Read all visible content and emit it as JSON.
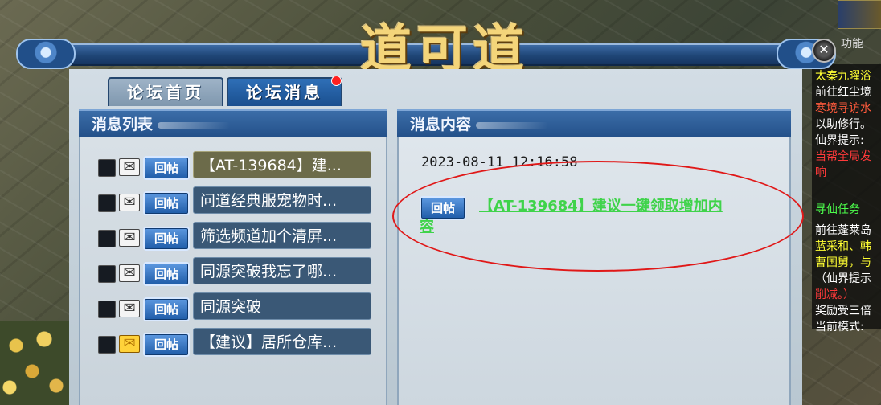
{
  "window": {
    "title": "道可道",
    "close_symbol": "✕"
  },
  "tabs": [
    {
      "label": "论坛首页",
      "active": false
    },
    {
      "label": "论坛消息",
      "active": true,
      "has_notification": true
    }
  ],
  "message_list": {
    "header": "消息列表",
    "reply_label": "回帖",
    "items": [
      {
        "title": "【AT-139684】建...",
        "selected": true,
        "unread": false
      },
      {
        "title": "问道经典服宠物时...",
        "selected": false,
        "unread": false
      },
      {
        "title": "筛选频道加个清屏...",
        "selected": false,
        "unread": false
      },
      {
        "title": "同源突破我忘了哪...",
        "selected": false,
        "unread": false
      },
      {
        "title": "同源突破",
        "selected": false,
        "unread": false
      },
      {
        "title": "【建议】居所仓库...",
        "selected": false,
        "unread": true
      }
    ]
  },
  "message_content": {
    "header": "消息内容",
    "timestamp": "2023-08-11 12:16:58",
    "reply_label": "回帖",
    "link_line1": "【AT-139684】建议一键领取增加内",
    "link_line2": "容"
  },
  "sidebar": {
    "top_label": "功能",
    "lines": [
      {
        "text": "太秦九曜浴",
        "color": "#ffff33"
      },
      {
        "text": "前往红尘境",
        "color": "#ffffff"
      },
      {
        "text": "寒境寻访水",
        "color": "#ff5a3c"
      },
      {
        "text": "以助修行。",
        "color": "#ffffff"
      },
      {
        "text": "仙界提示:",
        "color": "#ffffff"
      },
      {
        "text": "当帮全局发",
        "color": "#ff3a3a"
      },
      {
        "text": "响",
        "color": "#ff3a3a"
      },
      {
        "text": "寻仙任务",
        "color": "#4cff4c"
      },
      {
        "text": "前往蓬莱岛",
        "color": "#ffffff"
      },
      {
        "text": "蓝采和、韩",
        "color": "#ffff33"
      },
      {
        "text": "曹国舅，与",
        "color": "#ffff33"
      },
      {
        "text": "（仙界提示",
        "color": "#ffffff"
      },
      {
        "text": "削减。）",
        "color": "#ff3a3a"
      },
      {
        "text": "奖励受三倍",
        "color": "#ffffff"
      },
      {
        "text": "当前模式:",
        "color": "#ffffff"
      }
    ]
  }
}
